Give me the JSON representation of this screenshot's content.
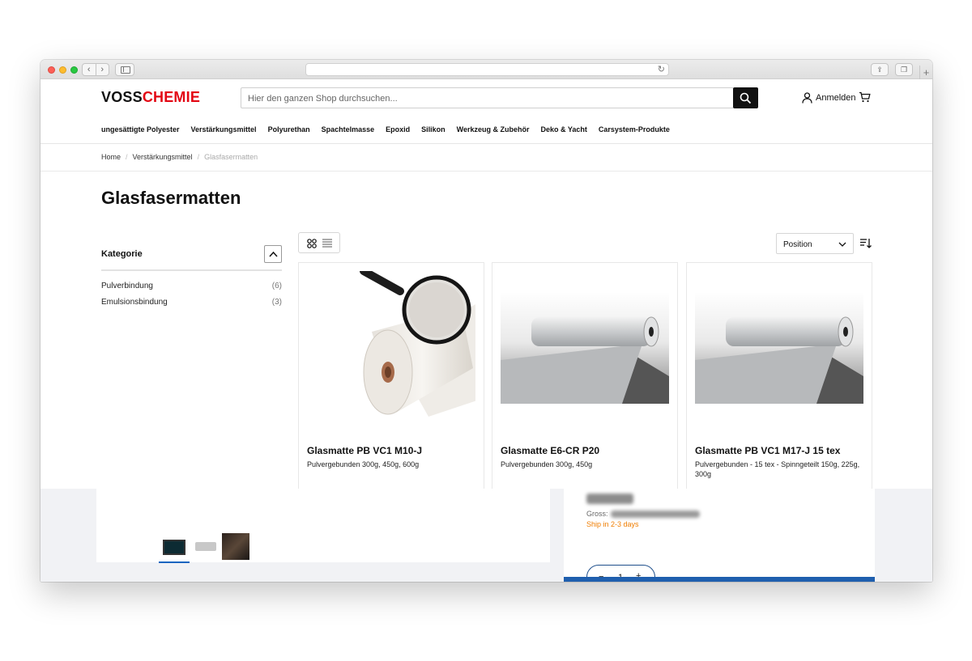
{
  "site": {
    "logo_part1": "VOSS",
    "logo_part2": "CHEMIE",
    "search_placeholder": "Hier den ganzen Shop durchsuchen...",
    "login_label": "Anmelden"
  },
  "nav": [
    "ungesättigte Polyester",
    "Verstärkungsmittel",
    "Polyurethan",
    "Spachtelmasse",
    "Epoxid",
    "Silikon",
    "Werkzeug & Zubehör",
    "Deko & Yacht",
    "Carsystem-Produkte"
  ],
  "breadcrumb": {
    "home": "Home",
    "parent": "Verstärkungsmittel",
    "current": "Glasfasermatten"
  },
  "page_title": "Glasfasermatten",
  "filter": {
    "title": "Kategorie",
    "items": [
      {
        "label": "Pulverbindung",
        "count": "(6)"
      },
      {
        "label": "Emulsionsbindung",
        "count": "(3)"
      }
    ]
  },
  "toolbar": {
    "sort_value": "Position"
  },
  "products": [
    {
      "name": "Glasmatte PB VC1 M10-J",
      "desc": "Pulvergebunden 300g, 450g, 600g"
    },
    {
      "name": "Glasmatte E6-CR P20",
      "desc": "Pulvergebunden 300g, 450g"
    },
    {
      "name": "Glasmatte PB VC1 M17-J 15 tex",
      "desc": "Pulvergebunden - 15 tex - Spinngeteilt 150g, 225g, 300g"
    }
  ],
  "lower": {
    "gross_label": "Gross:",
    "ship_text": "Ship in 2-3 days",
    "qty_minus": "−",
    "qty_value": "1",
    "qty_plus": "+"
  },
  "colors": {
    "brand_red": "#e30613",
    "accent_blue": "#1f5fae",
    "ship_orange": "#f07d00"
  }
}
